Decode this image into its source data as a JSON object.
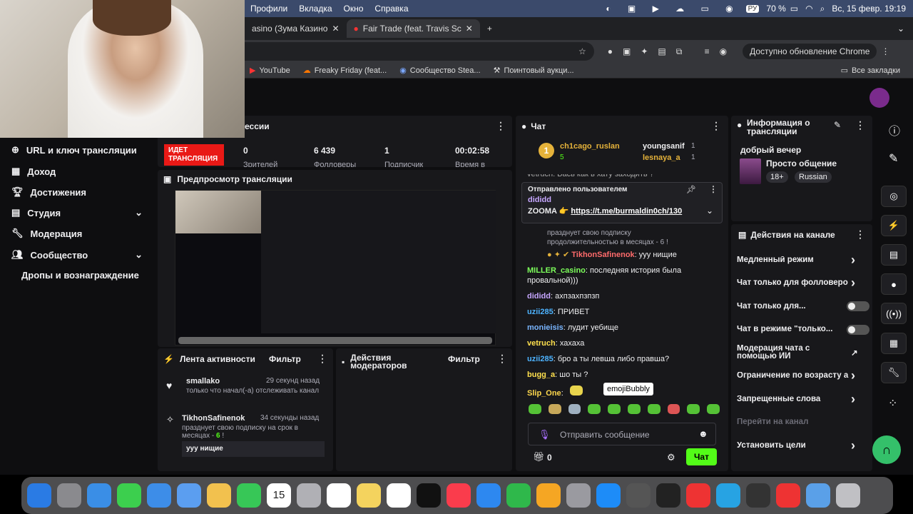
{
  "menubar": {
    "items": [
      "Профили",
      "Вкладка",
      "Окно",
      "Справка"
    ],
    "battery": "70 %",
    "lang": "РУ",
    "datetime": "Вс, 15 февр.  19:19"
  },
  "tabs": [
    {
      "label": "asino (Зума Казино"
    },
    {
      "label": "Fair Trade (feat. Travis Sc"
    }
  ],
  "addr": {
    "update": "Доступно обновление Chrome"
  },
  "bookmarks": [
    "YouTube",
    "Freaky Friday (feat...",
    "Сообщество Stea...",
    "Поинтовый аукци..."
  ],
  "all_bookmarks": "Все закладки",
  "sidebar": {
    "items": [
      "URL и ключ трансляции",
      "Доход",
      "Достижения",
      "Студия",
      "Модерация",
      "Сообщество",
      "Дропы и вознаграждение"
    ]
  },
  "session": {
    "title": "ессии",
    "live": "ИДЕТ ТРАНСЛЯЦИЯ",
    "stats": [
      "0",
      "6 439",
      "1",
      "00:02:58"
    ],
    "labels": [
      "Зрителей",
      "Фолловеры",
      "Подписчик",
      "Время в"
    ]
  },
  "preview": {
    "title": "Предпросмотр трансляции"
  },
  "activity": {
    "title": "Лента активности",
    "filter": "Фильтр",
    "items": [
      {
        "user": "smallako",
        "time": "29 секунд назад",
        "text": "только что начал(-а) отслеживать канал"
      },
      {
        "user": "TikhonSafinenok",
        "time": "34 секунды назад",
        "text": "празднует свою подписку на срок в месяцах - ",
        "months": "6",
        "excl": " !",
        "msg": "ууу нищие"
      }
    ]
  },
  "modactions": {
    "title": "Действия модераторов",
    "filter": "Фильтр"
  },
  "chat": {
    "title": "Чат",
    "top": [
      {
        "name": "ch1cago_ruslan",
        "count": "5",
        "rank": "1"
      },
      {
        "name": "youngsanif",
        "count": "1"
      },
      {
        "name": "lesnaya_a",
        "count": "1"
      }
    ],
    "pinned": {
      "label": "Отправлено пользователем",
      "user": "dididd",
      "text": "ZOOMA 👉 ",
      "link": "https://t.me/burmaldin0ch/130"
    },
    "partial": "vetruch: Вась как в хату заходить ?",
    "sub_text": "празднует свою подписку продолжительностью в месяцах - 6 !",
    "sub_user": "TikhonSafinenok",
    "sub_msg": ": ууу нищие",
    "messages": [
      {
        "user": "MILLER_casino",
        "color": "#7dff5b",
        "text": "последняя история была провальной)))"
      },
      {
        "user": "dididd",
        "color": "#c6a6ff",
        "text": "ахпзахпзпзп"
      },
      {
        "user": "uzii285",
        "color": "#4db3ff",
        "text": "ПРИВЕТ"
      },
      {
        "user": "monieisis",
        "color": "#79b5ff",
        "text": "лудит уебище"
      },
      {
        "user": "vetruch",
        "color": "#ffe04d",
        "text": "хахаха"
      },
      {
        "user": "uzii285",
        "color": "#4db3ff",
        "text": "бро а ты левша либо правша?"
      },
      {
        "user": "bugg_a",
        "color": "#ffe04d",
        "text": "шо ты ?"
      },
      {
        "user": "Slip_One",
        "color": "#ffd84d",
        "text": ""
      }
    ],
    "tooltip": "emojiBubbly",
    "input_placeholder": "Отправить сообщение",
    "points": "0",
    "send": "Чат"
  },
  "info": {
    "title": "Информация о трансляции",
    "stream_title": "добрый вечер",
    "category": "Просто общение",
    "tags": [
      "18+",
      "Russian"
    ]
  },
  "actions": {
    "title": "Действия на канале",
    "items": [
      {
        "label": "Медленный режим",
        "type": "arrow"
      },
      {
        "label": "Чат только для фолловеро",
        "type": "arrow"
      },
      {
        "label": "Чат только для...",
        "type": "toggle"
      },
      {
        "label": "Чат в режиме \"только...",
        "type": "toggle"
      },
      {
        "label": "Модерация чата с помощью ИИ",
        "type": "ext"
      },
      {
        "label": "Ограничение по возрасту а",
        "type": "arrow"
      },
      {
        "label": "Запрещенные слова",
        "type": "arrow"
      },
      {
        "label": "Перейти на канал",
        "type": "none"
      },
      {
        "label": "Установить цели",
        "type": "arrow"
      }
    ]
  },
  "dock_calendar": "15",
  "colors": {
    "accent": "#53fc18",
    "live": "#e91916",
    "panel": "#18181b"
  }
}
